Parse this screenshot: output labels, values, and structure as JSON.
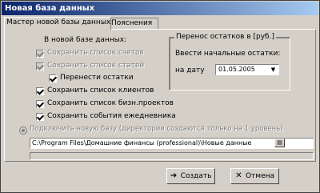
{
  "window": {
    "title": "Новая база данных"
  },
  "tabs": [
    {
      "label": "Мастер новой базы данных"
    },
    {
      "label": "Пояснения"
    }
  ],
  "section_title": "В новой базе данных:",
  "options": [
    {
      "label": "Сохранить список счетов",
      "checked": true,
      "enabled": false
    },
    {
      "label": "Сохранить список статей",
      "checked": true,
      "enabled": false
    },
    {
      "label": "Перенести остатки",
      "checked": true,
      "enabled": true
    },
    {
      "label": "Сохранить список клиентов",
      "checked": true,
      "enabled": true
    },
    {
      "label": "Сохранить список бизн.проектов",
      "checked": true,
      "enabled": true
    },
    {
      "label": "Сохранить события ежедневника",
      "checked": true,
      "enabled": true
    }
  ],
  "balance": {
    "group_title": "Перенос остатков в [руб.]",
    "prompt": "Ввести начальные остатки:",
    "date_label": "на дату",
    "date_value": "01.05.2005"
  },
  "connect": {
    "label": "Подключить новую базу  (директории создаются только на 1 уровень)",
    "path": "C:\\Program Files\\Домашние финансы (professional)\\Новые данные"
  },
  "buttons": {
    "create": "Создать",
    "cancel": "Отмена"
  }
}
